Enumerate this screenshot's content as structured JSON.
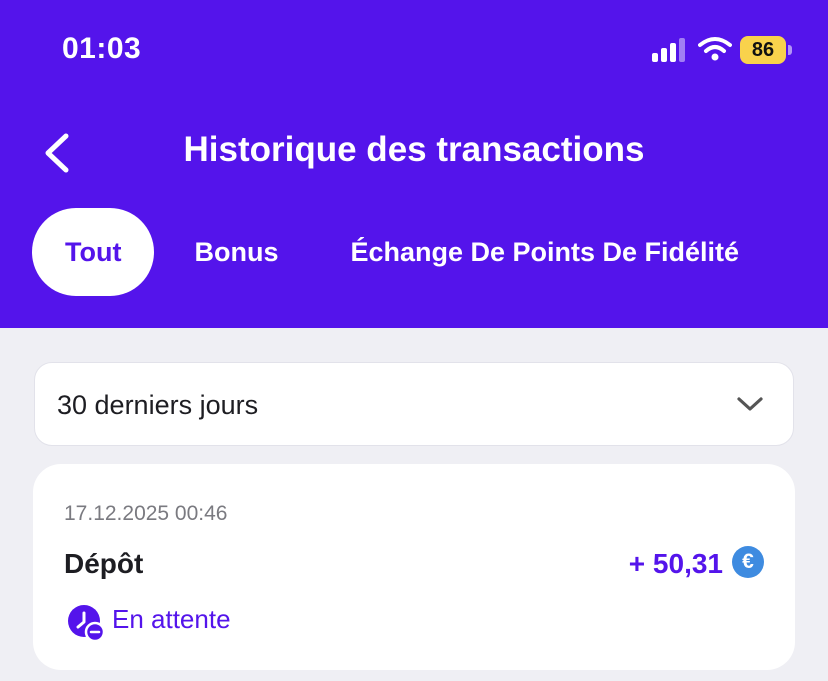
{
  "status_bar": {
    "time": "01:03",
    "battery": "86"
  },
  "header": {
    "title": "Historique des transactions"
  },
  "tabs": [
    {
      "label": "Tout",
      "active": true
    },
    {
      "label": "Bonus",
      "active": false
    },
    {
      "label": "Échange De Points De Fidélité",
      "active": false
    }
  ],
  "filter": {
    "selected": "30 derniers jours"
  },
  "transactions": [
    {
      "date": "17.12.2025 00:46",
      "type": "Dépôt",
      "amount": "+ 50,31",
      "currency_symbol": "€",
      "status": "En attente"
    }
  ],
  "colors": {
    "brand": "#5414EB",
    "background": "#EFEFF4",
    "currency_badge": "#3E8BE0",
    "battery": "#F9D24C"
  },
  "icons": [
    "back-arrow-icon",
    "signal-icon",
    "wifi-icon",
    "battery-icon",
    "chevron-down-icon",
    "euro-icon",
    "pending-clock-icon"
  ]
}
